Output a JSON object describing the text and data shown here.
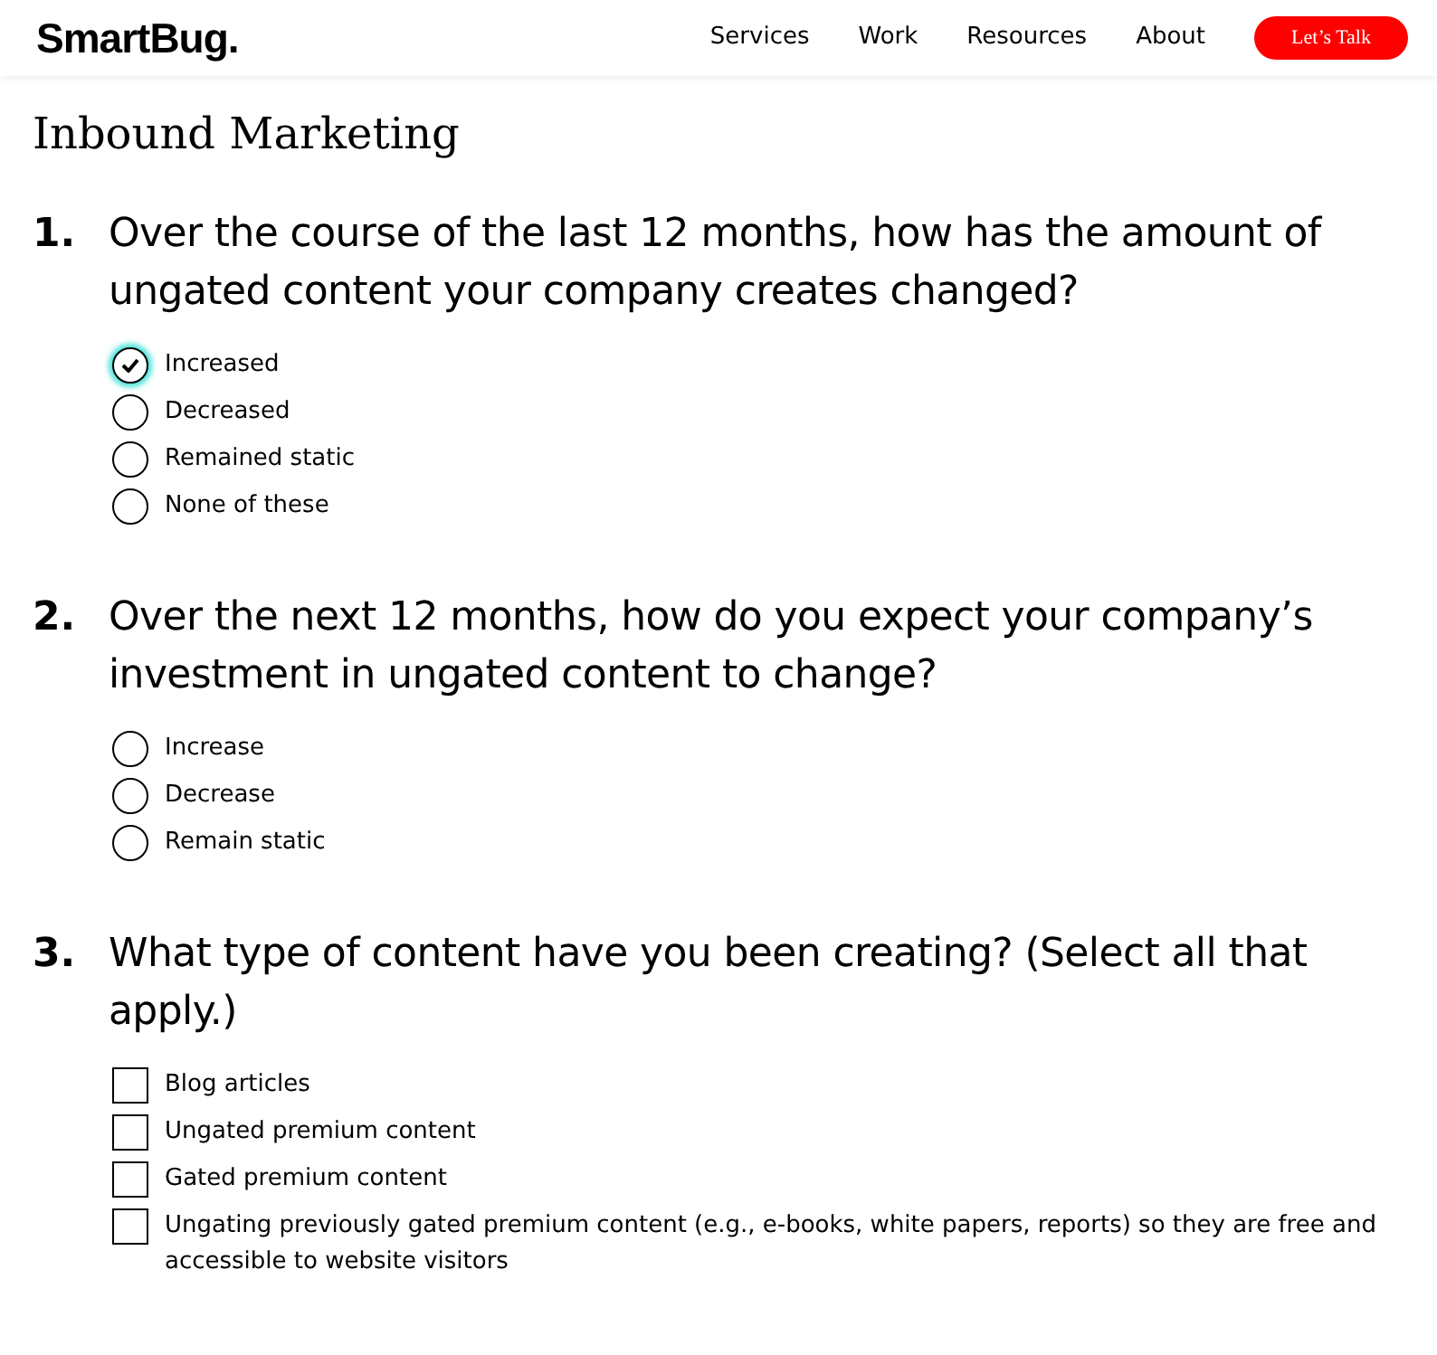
{
  "header": {
    "logo": "SmartBug.",
    "nav": [
      "Services",
      "Work",
      "Resources",
      "About"
    ],
    "cta": "Let’s Talk"
  },
  "title": "Inbound Marketing",
  "questions": [
    {
      "number": "1.",
      "text": "Over the course of the last 12 months, how has the amount of ungated content your company creates changed?",
      "kind": "radio",
      "options": [
        {
          "label": "Increased",
          "checked": true
        },
        {
          "label": "Decreased",
          "checked": false
        },
        {
          "label": "Remained static",
          "checked": false
        },
        {
          "label": "None of these",
          "checked": false
        }
      ]
    },
    {
      "number": "2.",
      "text": "Over the next 12 months, how do you expect your company’s investment in ungated content to change?",
      "kind": "radio",
      "options": [
        {
          "label": "Increase",
          "checked": false
        },
        {
          "label": "Decrease",
          "checked": false
        },
        {
          "label": "Remain static",
          "checked": false
        }
      ]
    },
    {
      "number": "3.",
      "text": "What type of content have you been creating? (Select all that apply.)",
      "kind": "checkbox",
      "options": [
        {
          "label": "Blog articles",
          "checked": false
        },
        {
          "label": "Ungated premium content",
          "checked": false
        },
        {
          "label": "Gated premium content",
          "checked": false
        },
        {
          "label": "Ungating previously gated premium content (e.g., e-books, white papers, reports) so they are free and accessible to website visitors",
          "checked": false
        }
      ]
    }
  ]
}
